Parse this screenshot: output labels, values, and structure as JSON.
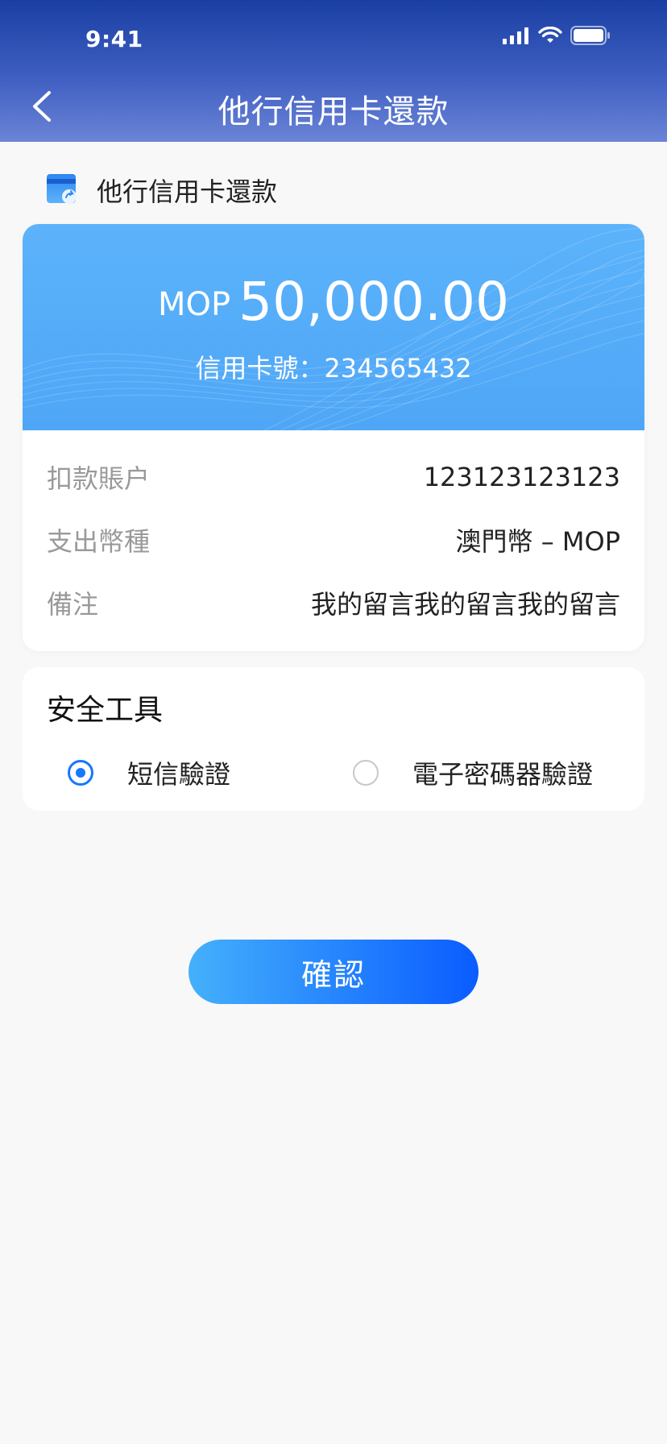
{
  "status_bar": {
    "time": "9:41"
  },
  "nav": {
    "title": "他行信用卡還款"
  },
  "section": {
    "title": "他行信用卡還款",
    "icon": "card-transfer-icon"
  },
  "summary": {
    "currency": "MOP",
    "amount": "50,000.00",
    "card_number_label": "信用卡號：",
    "card_number": "234565432"
  },
  "details": [
    {
      "label": "扣款賬户",
      "value": "123123123123"
    },
    {
      "label": "支出幣種",
      "value": "澳門幣 – MOP"
    },
    {
      "label": "備注",
      "value": "我的留言我的留言我的留言"
    }
  ],
  "security": {
    "title": "安全工具",
    "options": [
      {
        "label": "短信驗證",
        "selected": true
      },
      {
        "label": "電子密碼器驗證",
        "selected": false
      }
    ]
  },
  "confirm_button": {
    "label": "確認"
  },
  "colors": {
    "header_start": "#1a3fa3",
    "header_end": "#6a84d6",
    "card_blue": "#5cb3fb",
    "accent": "#1677ff",
    "button_start": "#44b0fb",
    "button_end": "#0a5cff"
  }
}
